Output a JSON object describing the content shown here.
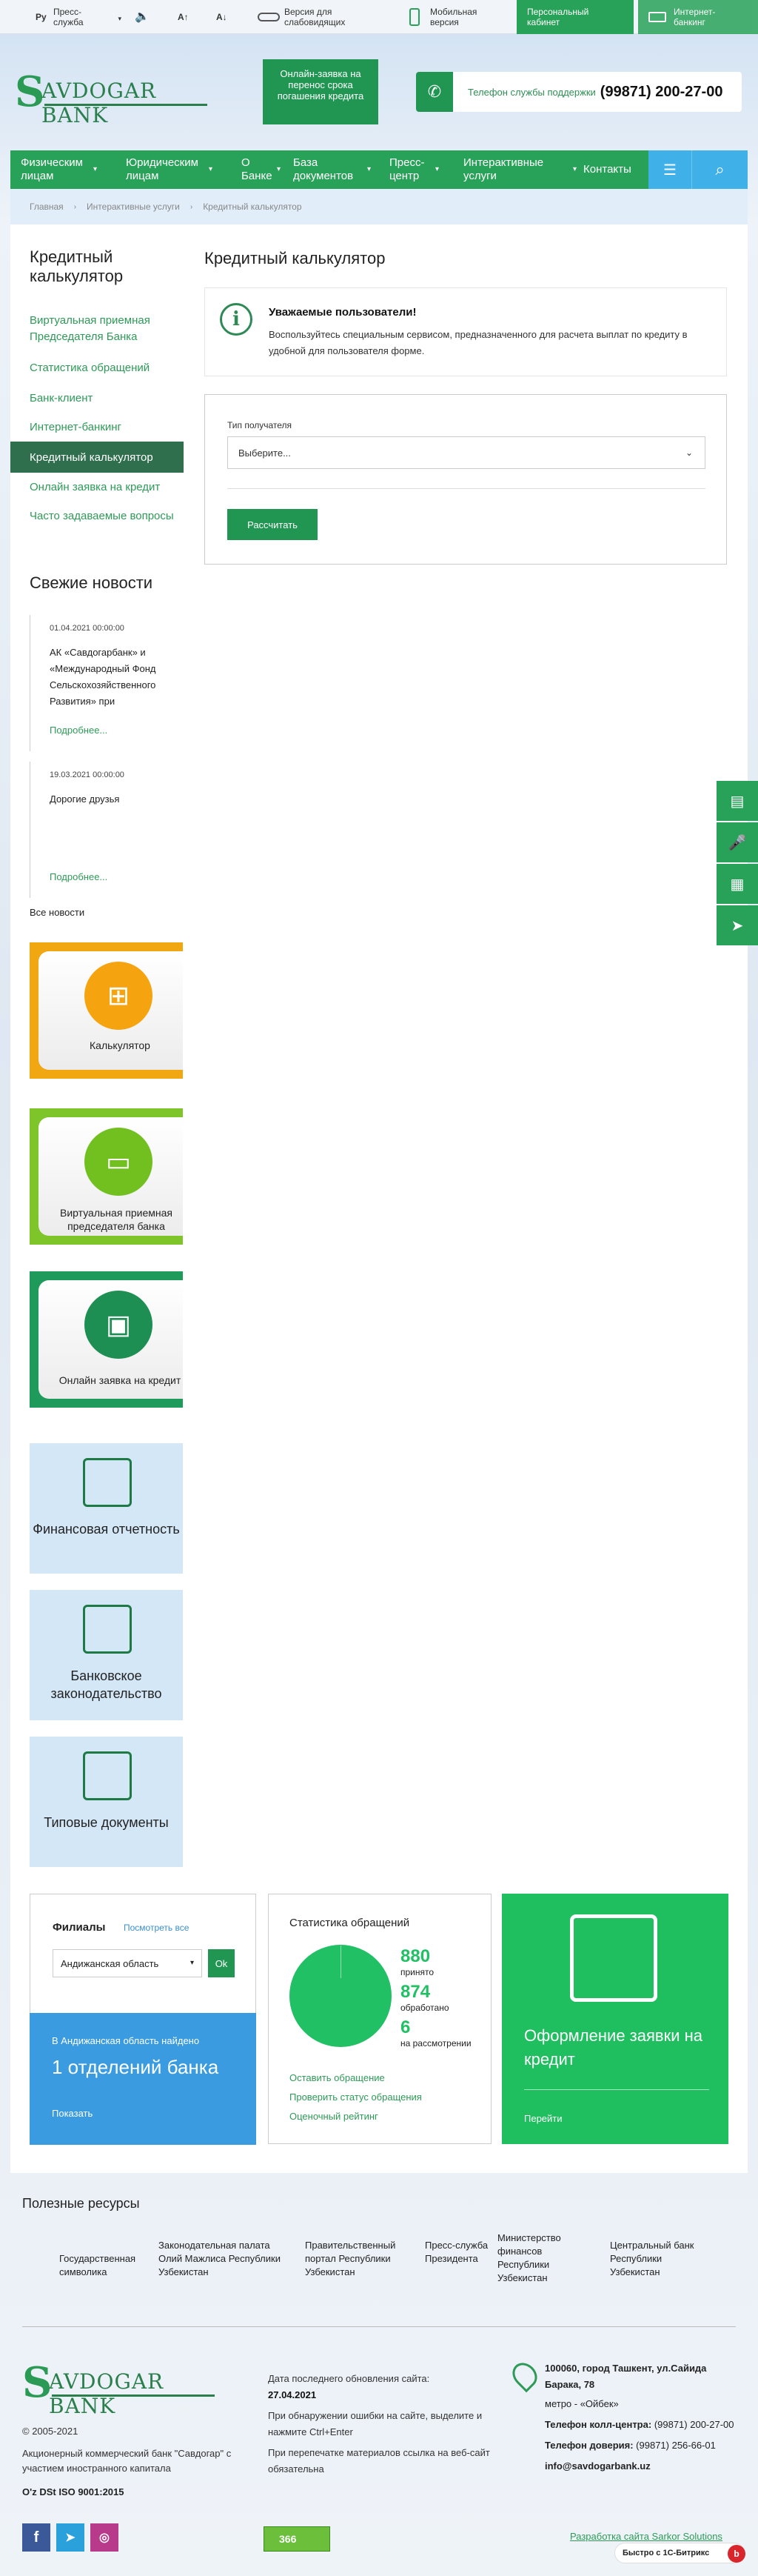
{
  "topbar": {
    "lang": "Ру",
    "press": "Пресс-служба",
    "font_up": "A↑",
    "font_down": "A↓",
    "impaired": "Версия для слабовидящих",
    "mobile": "Мобильная версия",
    "cabinet": "Персональный кабинет",
    "internet_bank": "Интернет-банкинг"
  },
  "header": {
    "logo_letter": "S",
    "logo_text": "AVDOGAR BANK",
    "loan_button": "Онлайн-заявка на перенос срока погашения кредита",
    "support_label": "Телефон службы поддержки",
    "support_phone": "(99871) 200-27-00"
  },
  "nav": {
    "items": [
      {
        "label": "Физическим лицам"
      },
      {
        "label": "Юридическим лицам"
      },
      {
        "label": "О Банке"
      },
      {
        "label": "База документов"
      },
      {
        "label": "Пресс-центр"
      },
      {
        "label": "Интерактивные услуги"
      },
      {
        "label": "Контакты"
      }
    ]
  },
  "breadcrumb": [
    "Главная",
    "Интерактивные услуги",
    "Кредитный калькулятор"
  ],
  "sidebar": {
    "title": "Кредитный калькулятор",
    "links": [
      "Виртуальная приемная Председателя Банка",
      "Статистика обращений",
      "Банк-клиент",
      "Интернет-банкинг",
      "Кредитный калькулятор",
      "Онлайн заявка на кредит",
      "Часто задаваемые вопросы"
    ],
    "news_title": "Свежие новости",
    "news": [
      {
        "date": "01.04.2021 00:00:00",
        "text": "АК «Савдогарбанк» и «Международный Фонд Сельскохозяйственного Развития» при",
        "more": "Подробнее..."
      },
      {
        "date": "19.03.2021 00:00:00",
        "text": "Дорогие друзья",
        "more": "Подробнее..."
      }
    ],
    "all_news": "Все новости",
    "tiles": [
      {
        "label": "Калькулятор",
        "color": "#f1a712",
        "circle": "#f5a40f"
      },
      {
        "label": "Виртуальная приемная председателя банка",
        "color": "#7ec52a",
        "circle": "#72c01f"
      },
      {
        "label": "Онлайн заявка на кредит",
        "color": "#1e9a5a",
        "circle": "#1e8f52"
      }
    ],
    "light_tiles": [
      "Финансовая отчетность",
      "Банковское законодательство",
      "Типовые документы"
    ]
  },
  "main": {
    "title": "Кредитный калькулятор",
    "notice_title": "Уважаемые пользователи!",
    "notice_text": "Воспользуйтесь специальным сервисом, предназначенного для расчета выплат по кредиту в удобной для пользователя форме.",
    "form_label": "Тип получателя",
    "form_select": "Выберите...",
    "form_button": "Рассчитать"
  },
  "widgets": {
    "branches_title": "Филиалы",
    "branches_link": "Посмотреть все",
    "branches_select": "Андижанская область",
    "ok": "Ok",
    "found_text": "В Андижанская область найдено",
    "found_count": "1 отделений банка",
    "show": "Показать",
    "stats_title": "Статистика обращений",
    "accepted_num": "880",
    "accepted_label": "принято",
    "processed_num": "874",
    "processed_label": "обработано",
    "review_num": "6",
    "review_label": "на рассмотрении",
    "stats_links": [
      "Оставить обращение",
      "Проверить статус обращения",
      "Оценочный рейтинг"
    ],
    "loan_title": "Оформление заявки на кредит",
    "loan_link": "Перейти"
  },
  "resources": {
    "title": "Полезные ресурсы",
    "items": [
      "Государственная символика",
      "Законодательная палата Олий Мажлиса Республики Узбекистан",
      "Правительственный портал Республики Узбекистан",
      "Пресс-служба Президента",
      "Министерство финансов Республики Узбекистан",
      "Центральный банк Республики Узбекистан"
    ]
  },
  "footer": {
    "copyright": "© 2005-2021",
    "company": "Акционерный коммерческий банк \"Савдогар\" с участием иностранного капитала",
    "iso": "O'z DSt ISO 9001:2015",
    "updated_label": "Дата последнего обновления сайта:",
    "updated_date": "27.04.2021",
    "error_note": "При обнаружении ошибки на сайте, выделите и нажмите Ctrl+Enter",
    "reprint_note": "При перепечатке материалов ссылка на веб-сайт обязательна",
    "address": "100060, город Ташкент, ул.Сайида Барака, 78",
    "metro": "метро - «Ойбек»",
    "callcenter_label": "Телефон колл-центра:",
    "callcenter": "(99871) 200-27-00",
    "trust_label": "Телефон доверия:",
    "trust": "(99871) 256-66-01",
    "email": "info@savdogarbank.uz",
    "counter": "366",
    "developer": "Разработка сайта Sarkor Solutions",
    "bitrix": "Быстро с 1С-Битрикс"
  }
}
